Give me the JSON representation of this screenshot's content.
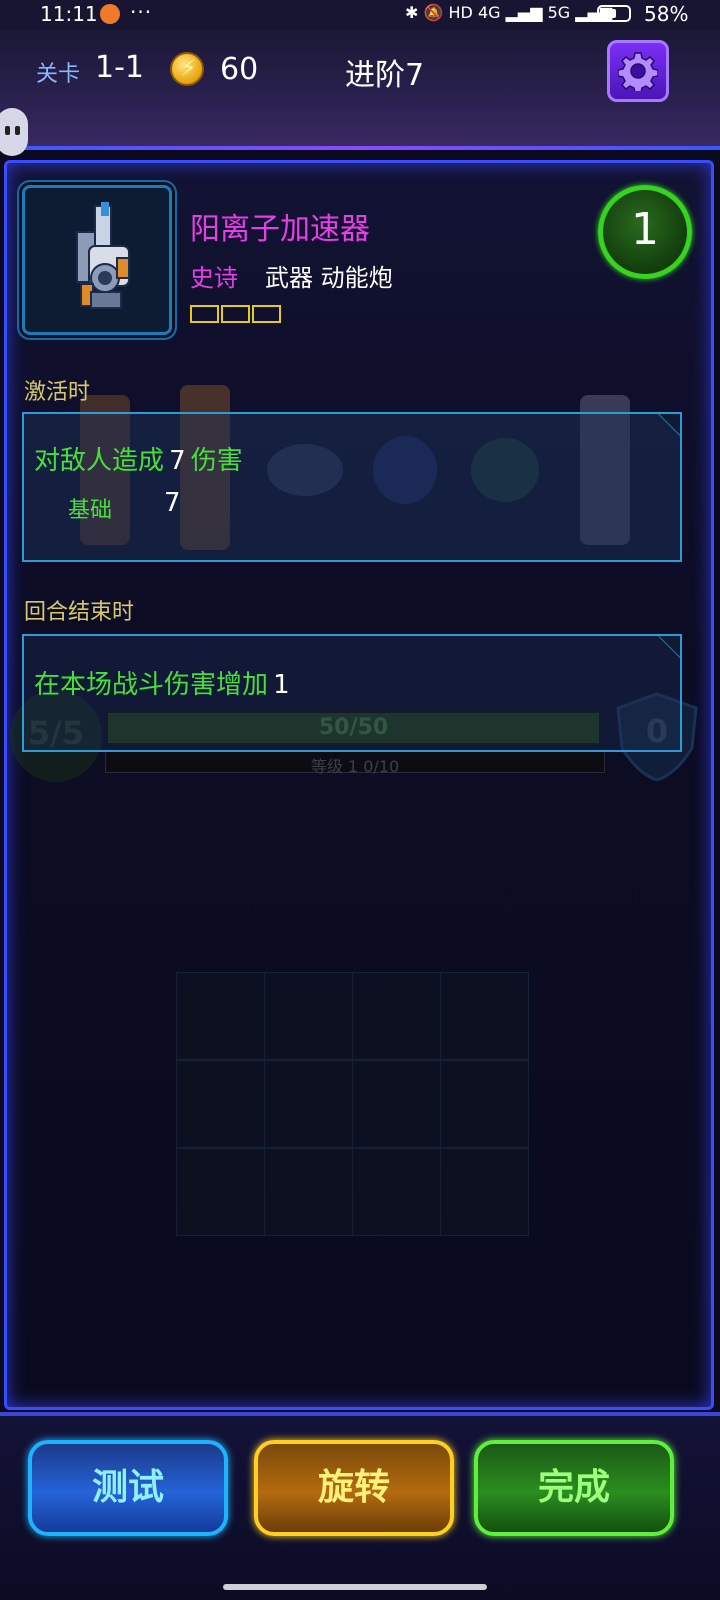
{
  "status_bar": {
    "time": "11:11",
    "more": "···",
    "indicators": "✱ 🔕 HD 4G ▂▄▆ 5G ▂▄▆",
    "battery_level": 0.58,
    "battery_percent": "58%"
  },
  "header": {
    "level_label": "关卡",
    "level_value": "1-1",
    "coins": "60",
    "coin_glyph": "⚡",
    "stage_text": "进阶7",
    "settings_icon": "gear-icon"
  },
  "item": {
    "name": "阳离子加速器",
    "rarity": "史诗",
    "types": "武器 动能炮",
    "cost": "1",
    "slot_count": 3,
    "colors": {
      "name": "#e53fe6",
      "slot": "#e6cc1a",
      "cost": "#39d221"
    }
  },
  "effects": [
    {
      "section_label": "激活时",
      "main_text": "对敌人造成",
      "main_value": "7",
      "main_suffix": "伤害",
      "sub_label": "基础",
      "sub_value": "7"
    },
    {
      "section_label": "回合结束时",
      "main_text": "在本场战斗伤害增加",
      "main_value": "1"
    }
  ],
  "background": {
    "hp_left": "5/5",
    "hp_bar": "50/50",
    "level_text": "等级 1  0/10",
    "shield_value": "0"
  },
  "buttons": {
    "test": "测试",
    "rotate": "旋转",
    "done": "完成"
  }
}
